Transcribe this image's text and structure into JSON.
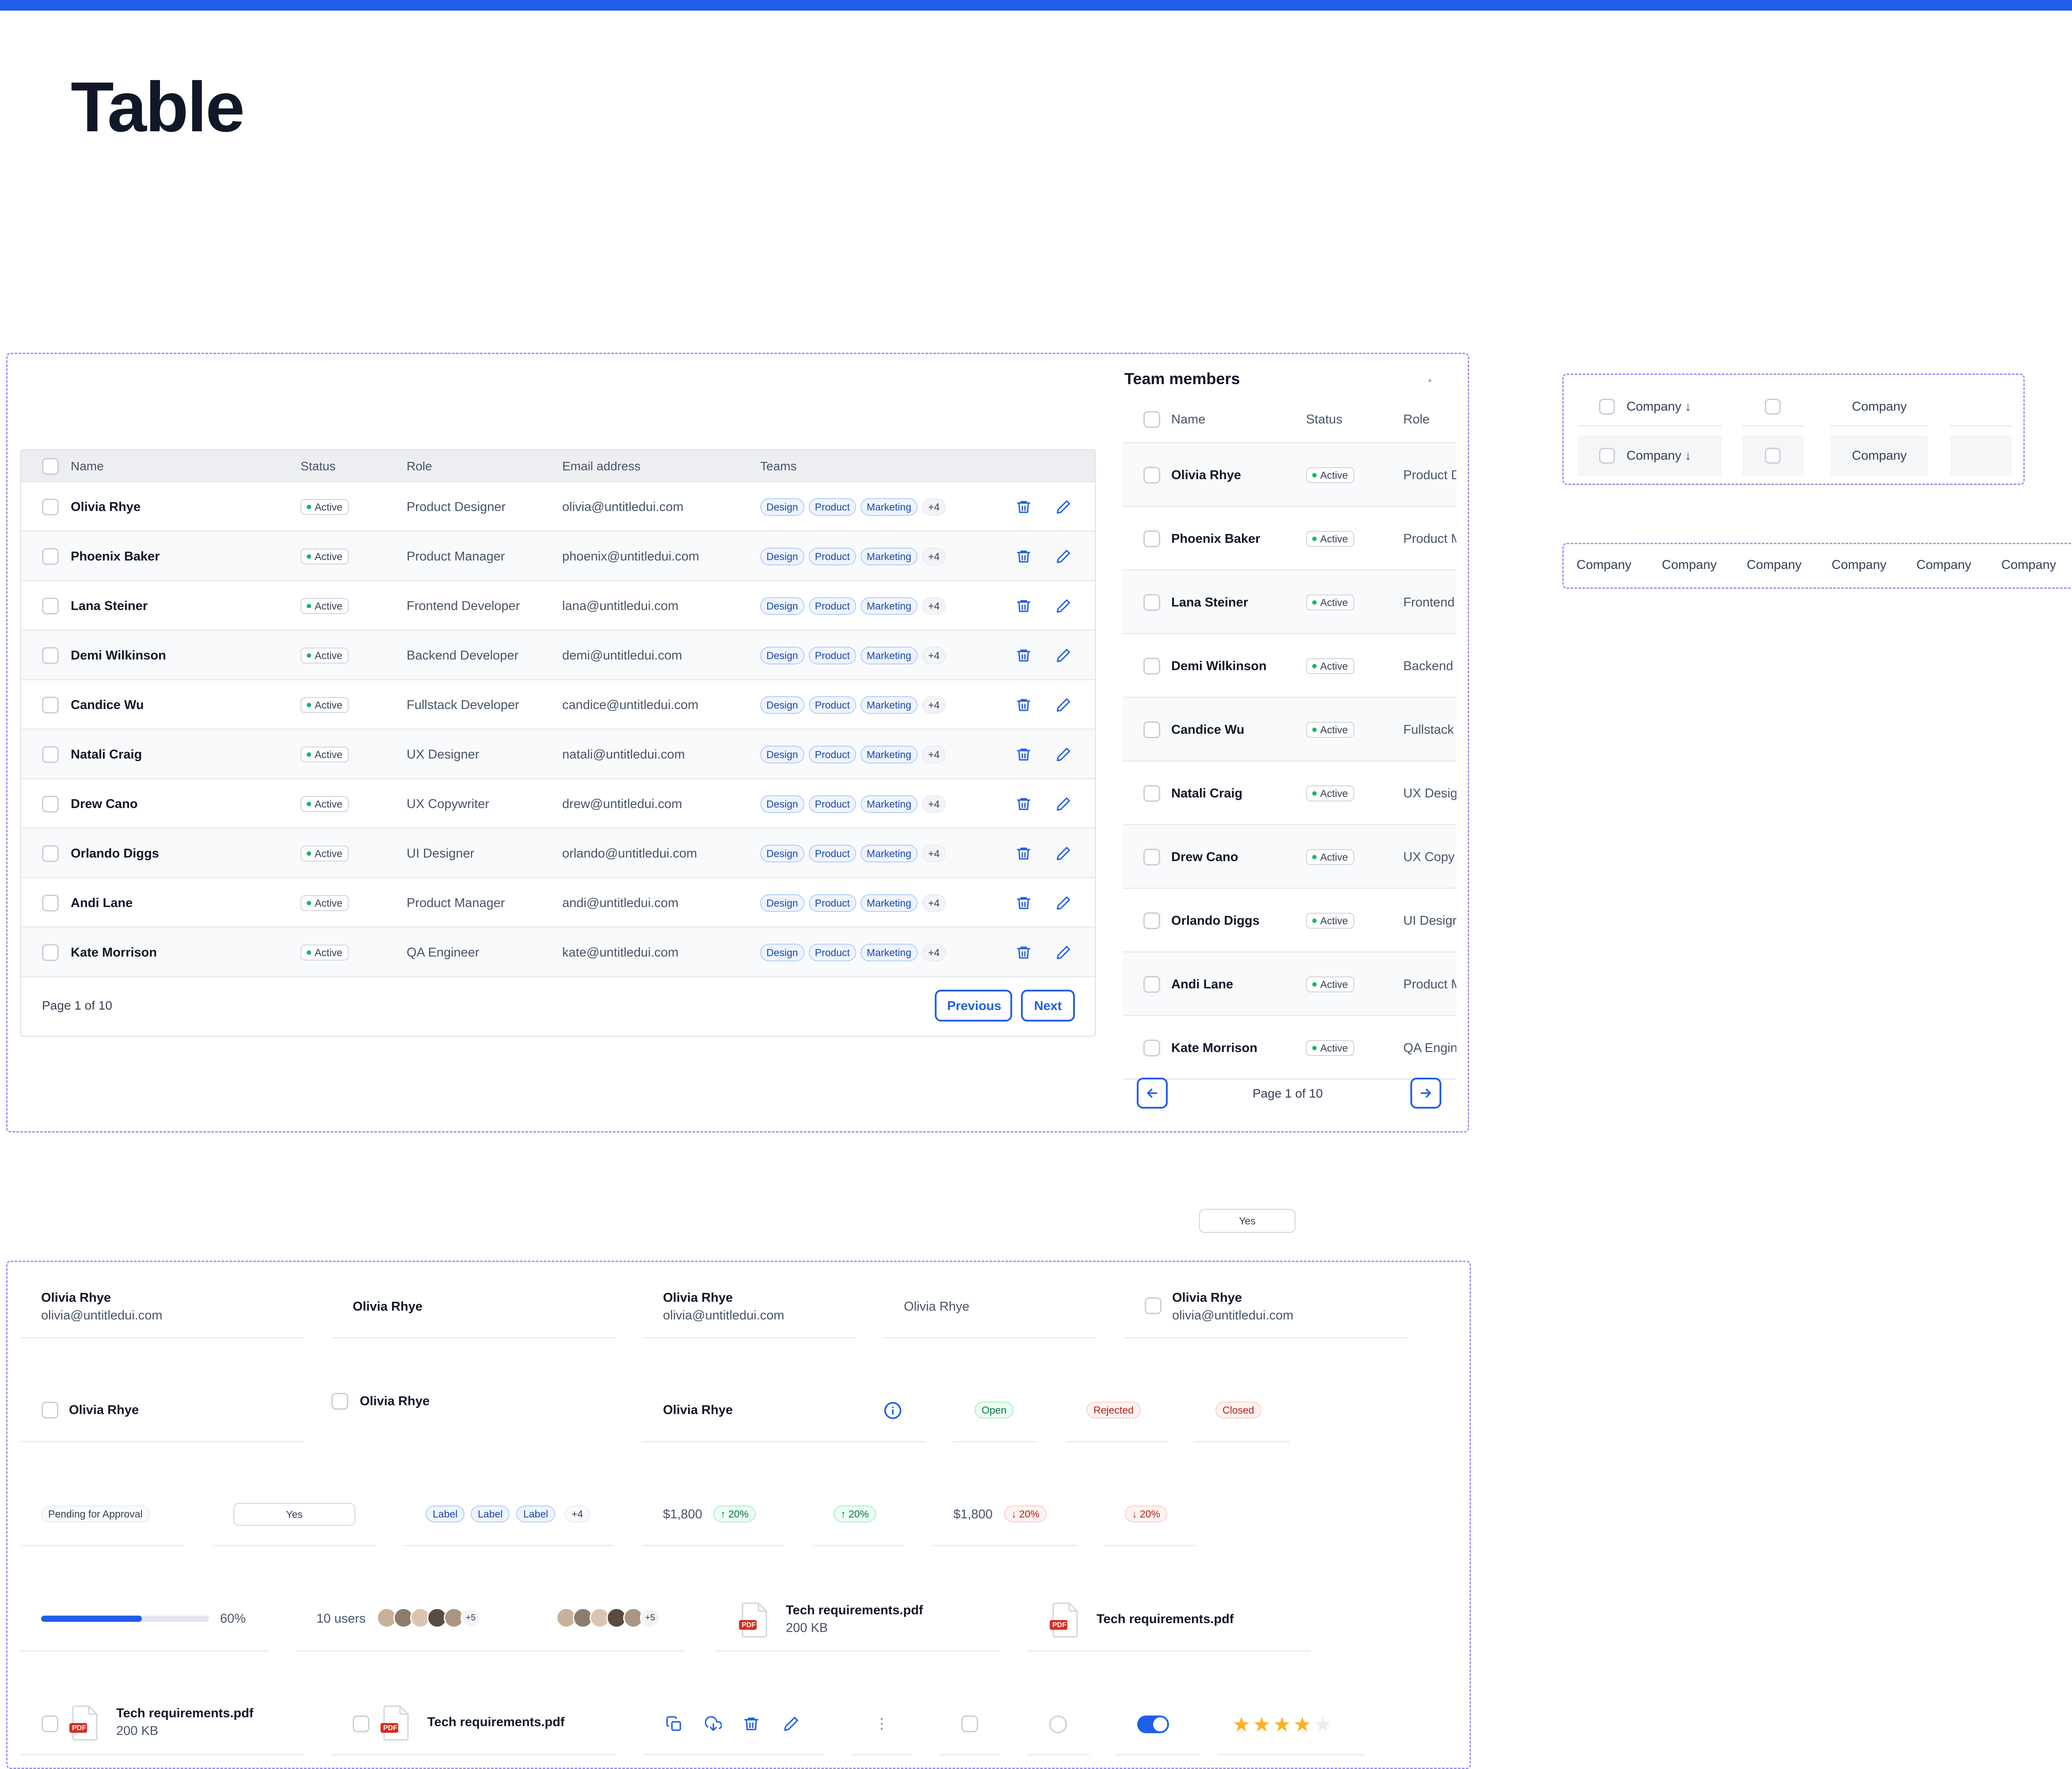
{
  "page": {
    "title": "Table"
  },
  "main_table": {
    "columns": [
      "Name",
      "Status",
      "Role",
      "Email address",
      "Teams"
    ],
    "rows": [
      {
        "name": "Olivia Rhye",
        "status": "Active",
        "role": "Product Designer",
        "email": "olivia@untitledui.com"
      },
      {
        "name": "Phoenix Baker",
        "status": "Active",
        "role": "Product Manager",
        "email": "phoenix@untitledui.com"
      },
      {
        "name": "Lana Steiner",
        "status": "Active",
        "role": "Frontend Developer",
        "email": "lana@untitledui.com"
      },
      {
        "name": "Demi Wilkinson",
        "status": "Active",
        "role": "Backend Developer",
        "email": "demi@untitledui.com"
      },
      {
        "name": "Candice Wu",
        "status": "Active",
        "role": "Fullstack Developer",
        "email": "candice@untitledui.com"
      },
      {
        "name": "Natali Craig",
        "status": "Active",
        "role": "UX Designer",
        "email": "natali@untitledui.com"
      },
      {
        "name": "Drew Cano",
        "status": "Active",
        "role": "UX Copywriter",
        "email": "drew@untitledui.com"
      },
      {
        "name": "Orlando Diggs",
        "status": "Active",
        "role": "UI Designer",
        "email": "orlando@untitledui.com"
      },
      {
        "name": "Andi Lane",
        "status": "Active",
        "role": "Product Manager",
        "email": "andi@untitledui.com"
      },
      {
        "name": "Kate Morrison",
        "status": "Active",
        "role": "QA Engineer",
        "email": "kate@untitledui.com"
      }
    ],
    "teams": [
      "Design",
      "Product",
      "Marketing",
      "+4"
    ],
    "pagination": {
      "text": "Page 1 of 10",
      "previous": "Previous",
      "next": "Next"
    }
  },
  "side_table": {
    "title": "Team members",
    "columns": [
      "Name",
      "Status",
      "Role"
    ],
    "rows": [
      {
        "name": "Olivia Rhye",
        "status": "Active",
        "role": "Product D"
      },
      {
        "name": "Phoenix Baker",
        "status": "Active",
        "role": "Product M"
      },
      {
        "name": "Lana Steiner",
        "status": "Active",
        "role": "Frontend"
      },
      {
        "name": "Demi Wilkinson",
        "status": "Active",
        "role": "Backend"
      },
      {
        "name": "Candice Wu",
        "status": "Active",
        "role": "Fullstack"
      },
      {
        "name": "Natali Craig",
        "status": "Active",
        "role": "UX Desig"
      },
      {
        "name": "Drew Cano",
        "status": "Active",
        "role": "UX Copy"
      },
      {
        "name": "Orlando Diggs",
        "status": "Active",
        "role": "UI Desigr"
      },
      {
        "name": "Andi Lane",
        "status": "Active",
        "role": "Product M"
      },
      {
        "name": "Kate Morrison",
        "status": "Active",
        "role": "QA Engin"
      }
    ],
    "pagination": {
      "text": "Page 1 of 10"
    }
  },
  "header_variants": {
    "company": "Company",
    "sorted_label": "Company ↓"
  },
  "cells": {
    "name": "Olivia Rhye",
    "email": "olivia@untitledui.com",
    "badges": {
      "open": "Open",
      "rejected": "Rejected",
      "closed": "Closed",
      "pending": "Pending for Approval"
    },
    "yes": "Yes",
    "labels": [
      "Label",
      "Label",
      "Label",
      "+4"
    ],
    "amount": "$1,800",
    "trend_up": "20%",
    "trend_down": "20%",
    "progress": {
      "value": 0.6,
      "label": "60%"
    },
    "users_label": "10 users",
    "avatars_more": "+5",
    "file": {
      "name": "Tech requirements.pdf",
      "size": "200 KB",
      "type": "PDF"
    },
    "rating": 4
  },
  "colors": {
    "accent": "#1f5ee8",
    "success": "#12b76a",
    "error": "#b42318",
    "star": "#fdb022"
  }
}
